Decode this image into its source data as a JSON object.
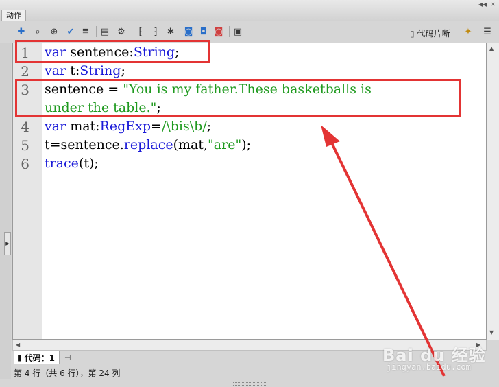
{
  "panel": {
    "title": "动作"
  },
  "toolbar": {
    "icons": [
      "add-statement-icon",
      "find-icon",
      "target-icon",
      "check-syntax-icon",
      "auto-format-icon",
      "code-hint-icon",
      "debug-options-icon",
      "collapse-between-braces-icon",
      "collapse-selection-icon",
      "expand-all-icon",
      "apply-block-comment-icon",
      "apply-line-comment-icon",
      "remove-comment-icon",
      "show-hide-toolbox-icon"
    ],
    "snippets_label": "代码片断",
    "wizard_icon": "magic-wand-icon",
    "menu_icon": "panel-menu-icon"
  },
  "editor": {
    "line_numbers": [
      "1",
      "2",
      "3",
      "",
      "4",
      "5",
      "6"
    ],
    "lines": [
      {
        "kw": "var",
        "rest": " sentence:",
        "type": "String",
        "tail": ";"
      },
      {
        "kw": "var",
        "rest": " t:",
        "type": "String",
        "tail": ";"
      },
      {
        "plain": "sentence = ",
        "str": "\"You is my father.These basketballs is"
      },
      {
        "str": "under the table.\"",
        "tail": ";"
      },
      {
        "kw": "var",
        "rest": " mat:",
        "type": "RegExp",
        "eq": "=",
        "rx": "/\\bis\\b/",
        "tail": ";"
      },
      {
        "plain": "t=sentence.",
        "fn": "replace",
        "args_a": "(mat,",
        "str": "\"are\"",
        "tail": ");"
      },
      {
        "fn": "trace",
        "plain": "(t);"
      }
    ]
  },
  "bottom_tab": {
    "label": "代码：1"
  },
  "status": {
    "text": "第 4 行（共 6 行），第 24 列"
  },
  "watermark": {
    "brand": "Bai du 经验",
    "url": "jingyan.baidu.com"
  },
  "colors": {
    "keyword": "#1a1ad8",
    "string": "#1f9a1f",
    "annotation": "#e33434"
  }
}
